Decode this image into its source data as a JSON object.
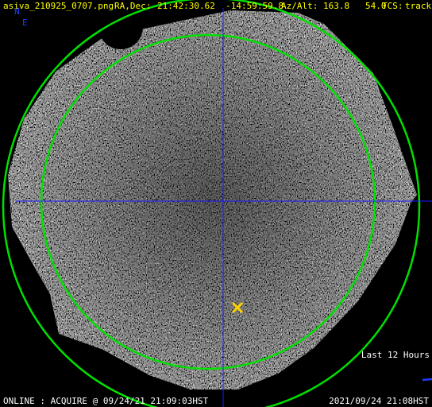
{
  "header": {
    "filename": "asiva_210925_0707.png",
    "radec_label": "RA,Dec:",
    "radec_value": "21:42:30.62  -14:59:59.8",
    "azalt_label": "Az/Alt:",
    "azalt_value": "163.8   54.0",
    "tcs_label": "TCS:",
    "tcs_value": "track"
  },
  "compass": {
    "north": "N",
    "east": "E"
  },
  "legend": {
    "label": "Last 12 Hours"
  },
  "status": {
    "left": "ONLINE : ACQUIRE @ 09/24/21 21:09:03HST",
    "right": "2021/09/24 21:08HST"
  },
  "colors": {
    "header_text": "#ffff00",
    "compass_text": "#1e3cff",
    "status_text": "#ffffff",
    "legend_text": "#ffffff",
    "legend_bar": "#1e3cff",
    "horizon_circle": "#00e000",
    "altitude_circle": "#00e000",
    "crosshair": "#1a1aff",
    "target_marker": "#ffd400",
    "background": "#000000"
  },
  "icons": {
    "target_marker": "x-marker-icon",
    "legend_track": "track-line-icon"
  }
}
